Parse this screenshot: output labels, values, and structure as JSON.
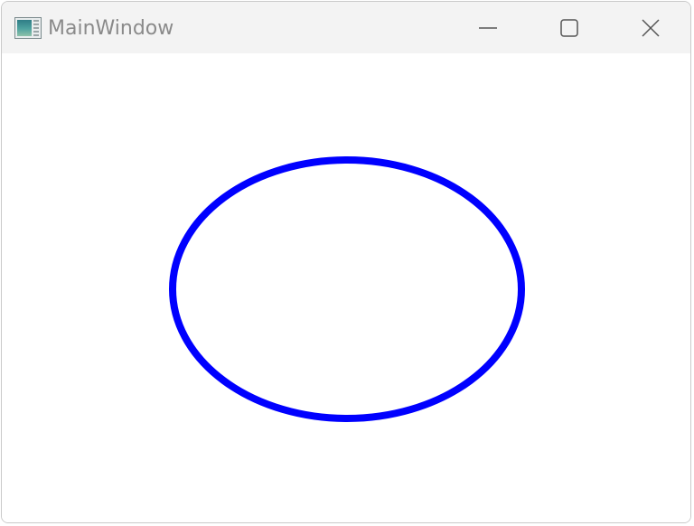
{
  "window": {
    "title": "MainWindow",
    "app_icon": "wpf-window-icon",
    "controls": {
      "minimize_icon": "minimize-icon",
      "maximize_icon": "maximize-icon",
      "close_icon": "close-icon"
    }
  },
  "canvas": {
    "shape": "ellipse",
    "stroke_color": "#0000ff",
    "fill_color": "none"
  }
}
